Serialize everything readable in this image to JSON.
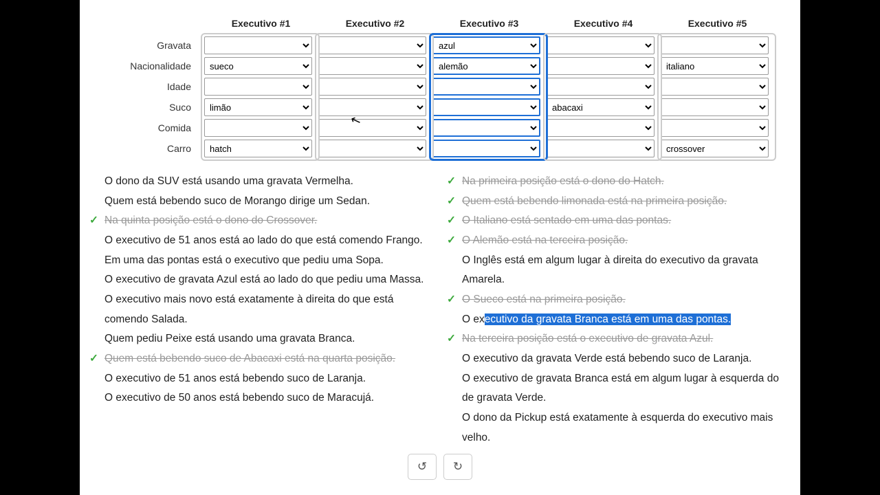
{
  "columns": [
    "Executivo #1",
    "Executivo #2",
    "Executivo #3",
    "Executivo #4",
    "Executivo #5"
  ],
  "rows": [
    "Gravata",
    "Nacionalidade",
    "Idade",
    "Suco",
    "Comida",
    "Carro"
  ],
  "highlight_col": 2,
  "values": {
    "0": {
      "0": "",
      "1": "sueco",
      "2": "",
      "3": "limão",
      "4": "",
      "5": "hatch"
    },
    "1": {
      "0": "",
      "1": "",
      "2": "",
      "3": "",
      "4": "",
      "5": ""
    },
    "2": {
      "0": "azul",
      "1": "alemão",
      "2": "",
      "3": "",
      "4": "",
      "5": ""
    },
    "3": {
      "0": "",
      "1": "",
      "2": "",
      "3": "abacaxi",
      "4": "",
      "5": ""
    },
    "4": {
      "0": "",
      "1": "italiano",
      "2": "",
      "3": "",
      "4": "",
      "5": "crossover"
    }
  },
  "clues_left": [
    {
      "t": "O dono da SUV está usando uma gravata Vermelha.",
      "d": false
    },
    {
      "t": "Quem está bebendo suco de Morango dirige um Sedan.",
      "d": false
    },
    {
      "t": "Na quinta posição está o dono do Crossover.",
      "d": true
    },
    {
      "t": "O executivo de 51 anos está ao lado do que está comendo Frango.",
      "d": false
    },
    {
      "t": "Em uma das pontas está o executivo que pediu uma Sopa.",
      "d": false
    },
    {
      "t": "O executivo de gravata Azul está ao lado do que pediu uma Massa.",
      "d": false
    },
    {
      "t": "O executivo mais novo está exatamente à direita do que está comendo Salada.",
      "d": false
    },
    {
      "t": "Quem pediu Peixe está usando uma gravata Branca.",
      "d": false
    },
    {
      "t": "Quem está bebendo suco de Abacaxi está na quarta posição.",
      "d": true
    },
    {
      "t": "O executivo de 51 anos está bebendo suco de Laranja.",
      "d": false
    },
    {
      "t": "O executivo de 50 anos está bebendo suco de Maracujá.",
      "d": false
    }
  ],
  "clues_right": [
    {
      "t": "Na primeira posição está o dono do Hatch.",
      "d": true
    },
    {
      "t": "Quem está bebendo limonada está na primeira posição.",
      "d": true
    },
    {
      "t": "O Italiano está sentado em uma das pontas.",
      "d": true
    },
    {
      "t": "O Alemão está na terceira posição.",
      "d": true
    },
    {
      "t": "O Inglês está em algum lugar à direita do executivo da gravata Amarela.",
      "d": false
    },
    {
      "t": "O Sueco está na primeira posição.",
      "d": true
    },
    {
      "t": "O executivo da gravata Branca está em uma das pontas.",
      "d": false,
      "sel": true,
      "sel_from": 4
    },
    {
      "t": "Na terceira posição está o executivo de gravata Azul.",
      "d": true
    },
    {
      "t": "O executivo da gravata Verde está bebendo suco de Laranja.",
      "d": false
    },
    {
      "t": "O executivo de gravata Branca está em algum lugar à esquerda do de gravata Verde.",
      "d": false
    },
    {
      "t": "O dono da Pickup está exatamente à esquerda do executivo mais velho.",
      "d": false
    }
  ],
  "undo": "↺",
  "redo": "↻"
}
